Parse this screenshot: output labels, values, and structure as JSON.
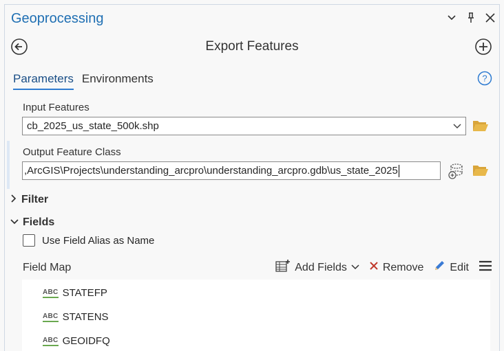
{
  "pane": {
    "title": "Geoprocessing",
    "tool_title": "Export Features"
  },
  "tabs": [
    {
      "label": "Parameters",
      "active": true
    },
    {
      "label": "Environments",
      "active": false
    }
  ],
  "params": {
    "input_label": "Input Features",
    "input_value": "cb_2025_us_state_500k.shp",
    "output_label": "Output Feature Class",
    "output_value": ",ArcGIS\\Projects\\understanding_arcpro\\understanding_arcpro.gdb\\us_state_2025"
  },
  "sections": {
    "filter": "Filter",
    "fields": "Fields"
  },
  "checkbox": {
    "label": "Use Field Alias as Name",
    "checked": false
  },
  "field_map": {
    "label": "Field Map",
    "add_fields": "Add Fields",
    "remove": "Remove",
    "edit": "Edit"
  },
  "fields": [
    {
      "type": "ABC",
      "name": "STATEFP"
    },
    {
      "type": "ABC",
      "name": "STATENS"
    },
    {
      "type": "ABC",
      "name": "GEOIDFQ"
    }
  ],
  "colors": {
    "accent": "#1f6fb3",
    "folder": "#e8b84a",
    "remove": "#c0392b",
    "type_underline": "#6aa84f"
  }
}
